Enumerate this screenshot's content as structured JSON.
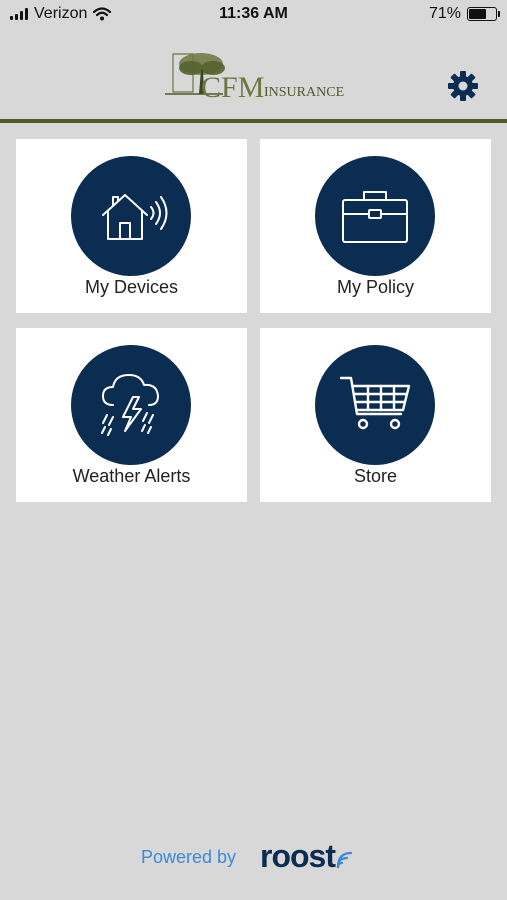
{
  "status_bar": {
    "carrier": "Verizon",
    "time": "11:36 AM",
    "battery_percent": "71%",
    "battery_level": 0.71
  },
  "header": {
    "logo_text_main": "CFM",
    "logo_text_sub": "INSURANCE",
    "settings_icon": "gear-icon",
    "accent_color": "#4d5a2c"
  },
  "tiles": [
    {
      "label": "My Devices",
      "icon": "house-signal-icon"
    },
    {
      "label": "My Policy",
      "icon": "briefcase-icon"
    },
    {
      "label": "Weather Alerts",
      "icon": "storm-cloud-icon"
    },
    {
      "label": "Store",
      "icon": "shopping-cart-icon"
    }
  ],
  "footer": {
    "powered_by": "Powered by",
    "brand": "roost"
  },
  "colors": {
    "background": "#d8d8d8",
    "tile_bg": "#ffffff",
    "icon_circle": "#0c2d52",
    "powered_text": "#3b8ad9"
  }
}
